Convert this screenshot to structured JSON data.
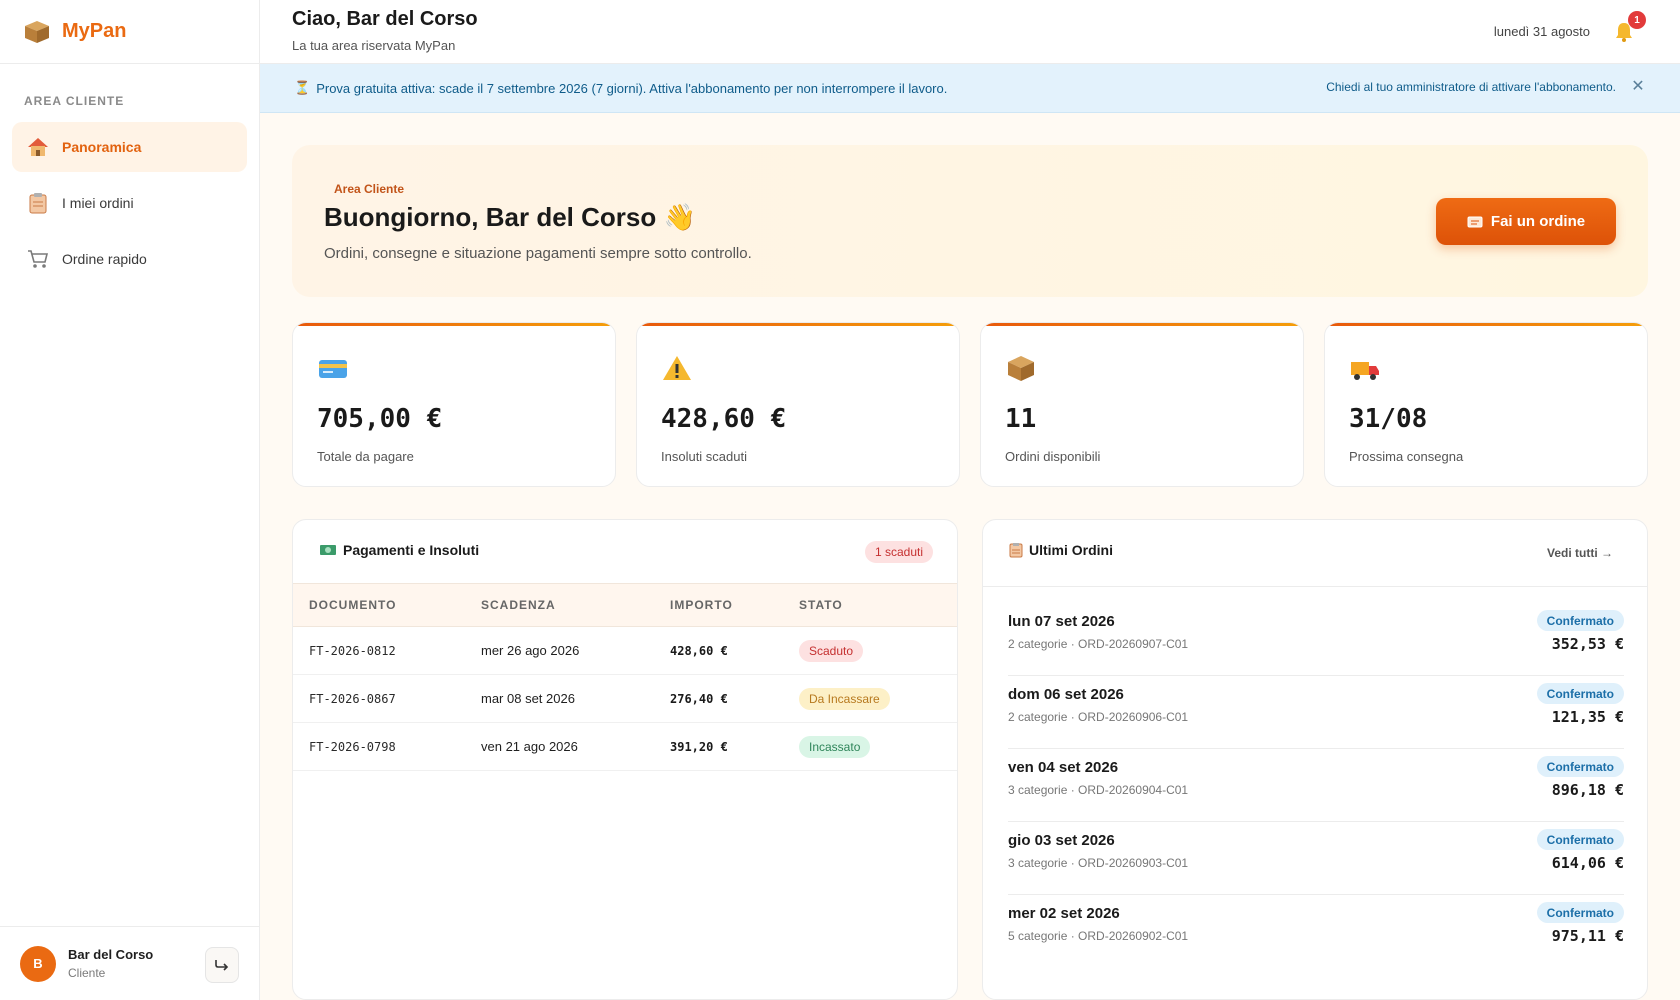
{
  "app": {
    "name": "MyPan"
  },
  "sidebar": {
    "section_label": "AREA CLIENTE",
    "items": [
      {
        "label": "Panoramica",
        "icon": "house-icon",
        "active": true
      },
      {
        "label": "I miei ordini",
        "icon": "clipboard-icon",
        "active": false
      },
      {
        "label": "Ordine rapido",
        "icon": "cart-icon",
        "active": false
      }
    ],
    "user": {
      "initial": "B",
      "name": "Bar del Corso",
      "role": "Cliente"
    }
  },
  "header": {
    "title": "Ciao, Bar del Corso",
    "subtitle": "La tua area riservata MyPan",
    "date": "lunedì 31 agosto",
    "notifications": "1"
  },
  "banner": {
    "message": "Prova gratuita attiva: scade il 7 settembre 2026 (7 giorni). Attiva l'abbonamento per non interrompere il lavoro.",
    "action": "Chiedi al tuo amministratore di attivare l'abbonamento."
  },
  "hero": {
    "tag": "Area Cliente",
    "title": "Buongiorno, Bar del Corso 👋",
    "subtitle": "Ordini, consegne e situazione pagamenti sempre sotto controllo.",
    "button": "Fai un ordine"
  },
  "stats": [
    {
      "icon": "credit-card-icon",
      "value": "705,00 €",
      "label": "Totale da pagare"
    },
    {
      "icon": "warning-icon",
      "value": "428,60 €",
      "label": "Insoluti scaduti"
    },
    {
      "icon": "package-icon",
      "value": "11",
      "label": "Ordini disponibili"
    },
    {
      "icon": "truck-icon",
      "value": "31/08",
      "label": "Prossima consegna"
    }
  ],
  "payments": {
    "title": "Pagamenti e Insoluti",
    "badge": "1 scaduti",
    "columns": [
      "DOCUMENTO",
      "SCADENZA",
      "IMPORTO",
      "STATO"
    ],
    "rows": [
      {
        "doc": "FT-2026-0812",
        "due": "mer 26 ago 2026",
        "amount": "428,60 €",
        "status": "Scaduto"
      },
      {
        "doc": "FT-2026-0867",
        "due": "mar 08 set 2026",
        "amount": "276,40 €",
        "status": "Da Incassare"
      },
      {
        "doc": "FT-2026-0798",
        "due": "ven 21 ago 2026",
        "amount": "391,20 €",
        "status": "Incassato"
      }
    ],
    "status_colors": {
      "Scaduto": {
        "bg": "#fde1e1",
        "fg": "#c53030"
      },
      "Da Incassare": {
        "bg": "#fdf0c7",
        "fg": "#b7791f"
      },
      "Incassato": {
        "bg": "#d9f5e6",
        "fg": "#2f855a"
      }
    }
  },
  "orders": {
    "title": "Ultimi Ordini",
    "link": "Vedi tutti →",
    "rows": [
      {
        "date": "lun 07 set 2026",
        "meta": "2 categorie · ORD-20260907-C01",
        "status": "Confermato",
        "amount": "352,53 €"
      },
      {
        "date": "dom 06 set 2026",
        "meta": "2 categorie · ORD-20260906-C01",
        "status": "Confermato",
        "amount": "121,35 €"
      },
      {
        "date": "ven 04 set 2026",
        "meta": "3 categorie · ORD-20260904-C01",
        "status": "Confermato",
        "amount": "896,18 €"
      },
      {
        "date": "gio 03 set 2026",
        "meta": "3 categorie · ORD-20260903-C01",
        "status": "Confermato",
        "amount": "614,06 €"
      },
      {
        "date": "mer 02 set 2026",
        "meta": "5 categorie · ORD-20260902-C01",
        "status": "Confermato",
        "amount": "975,11 €"
      }
    ]
  }
}
